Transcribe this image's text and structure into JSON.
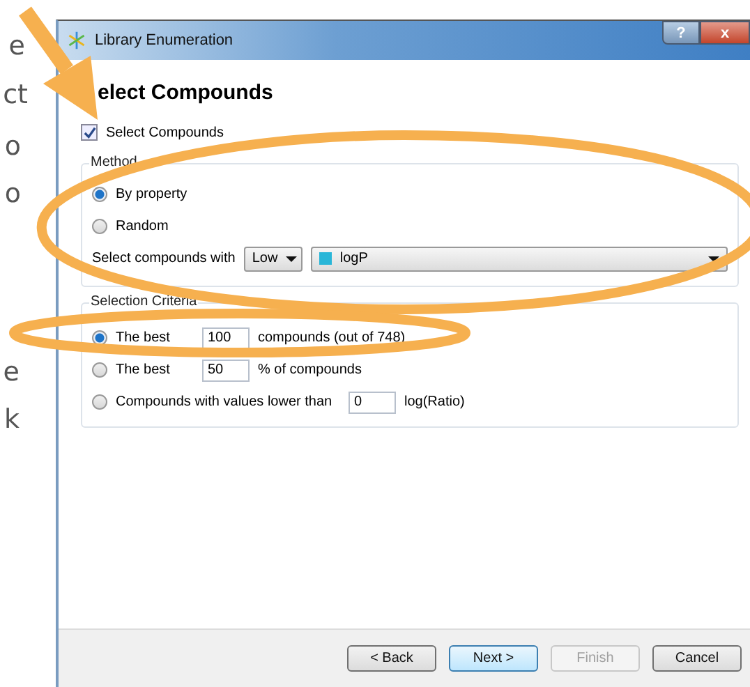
{
  "slide_text": [
    "e",
    "ct",
    "o",
    "o",
    "e",
    "k"
  ],
  "window": {
    "title": "Library Enumeration",
    "controls": [
      "?",
      "x"
    ]
  },
  "heading": "elect Compounds",
  "select_compounds": {
    "label": "Select Compounds",
    "checked": true
  },
  "method": {
    "title": "Method",
    "options": [
      {
        "label": "By property",
        "selected": true
      },
      {
        "label": "Random",
        "selected": false
      }
    ],
    "select_with_label": "Select compounds with",
    "level_dropdown": "Low",
    "property_dropdown": {
      "value": "logP",
      "color": "#29b6d8"
    }
  },
  "criteria": {
    "title": "Selection Criteria",
    "options": [
      {
        "label": "The best",
        "value": "100",
        "suffix": "compounds (out of 748)",
        "selected": true
      },
      {
        "label": "The best",
        "value": "50",
        "suffix": "% of compounds",
        "selected": false
      },
      {
        "label": "Compounds with values lower than",
        "value": "0",
        "suffix": "log(Ratio)",
        "selected": false
      }
    ]
  },
  "buttons": [
    {
      "label": "< Back",
      "default": false,
      "disabled": false
    },
    {
      "label": "Next >",
      "default": true,
      "disabled": false
    },
    {
      "label": "Finish",
      "default": false,
      "disabled": true
    },
    {
      "label": "Cancel",
      "default": false,
      "disabled": false
    }
  ]
}
